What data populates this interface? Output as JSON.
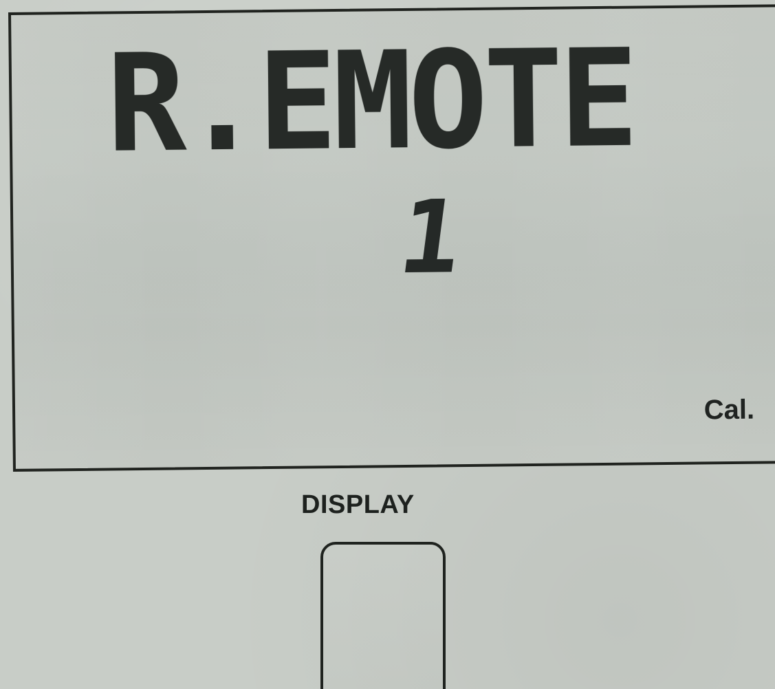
{
  "lcd": {
    "line1": "R.EMOTE",
    "line2": "1",
    "indicator": "Cal."
  },
  "controls": {
    "display_label": "DISPLAY"
  },
  "colors": {
    "background": "#c8cdc7",
    "lcd_text": "#262a27",
    "frame": "#20231f"
  }
}
